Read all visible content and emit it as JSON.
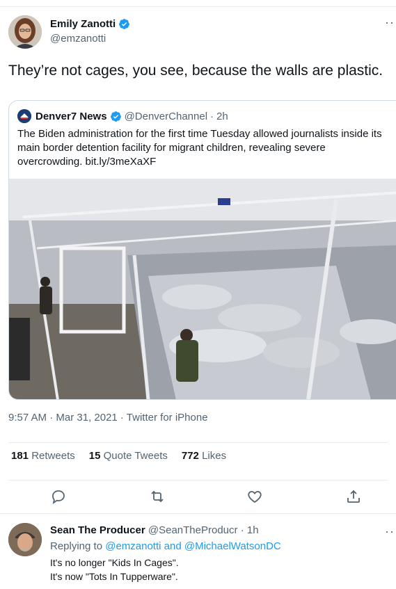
{
  "main_tweet": {
    "display_name": "Emily Zanotti",
    "handle": "@emzanotti",
    "more": "···",
    "text": "They’re not cages, you see, because the walls are plastic.",
    "timestamp": "9:57 AM · Mar 31, 2021 · Twitter for iPhone",
    "stats": {
      "retweets_count": "181",
      "retweets_label": "Retweets",
      "quotes_count": "15",
      "quotes_label": "Quote Tweets",
      "likes_count": "772",
      "likes_label": "Likes"
    }
  },
  "quoted_tweet": {
    "display_name": "Denver7 News",
    "handle": "@DenverChannel",
    "sep": "·",
    "time": "2h",
    "text": "The Biden administration for the first time Tuesday allowed journalists inside its main border detention facility for migrant children, revealing severe overcrowding. bit.ly/3meXaXF"
  },
  "reply": {
    "display_name": "Sean The Producer",
    "handle": "@SeanTheProducr",
    "sep": "·",
    "time": "1h",
    "replying_prefix": "Replying to",
    "mention_1": "@emzanotti",
    "and": "and",
    "mention_2": "@MichaelWatsonDC",
    "line1": "It's no longer \"Kids In Cages\".",
    "line2": "It's now \"Tots In Tupperware\".",
    "more": "··"
  },
  "icons": {
    "verified": "verified-badge-icon",
    "reply": "reply-icon",
    "retweet": "retweet-icon",
    "like": "heart-icon",
    "share": "share-icon"
  },
  "colors": {
    "accent": "#1d9bf0",
    "text_secondary": "#536471",
    "border": "#cfd9de"
  }
}
